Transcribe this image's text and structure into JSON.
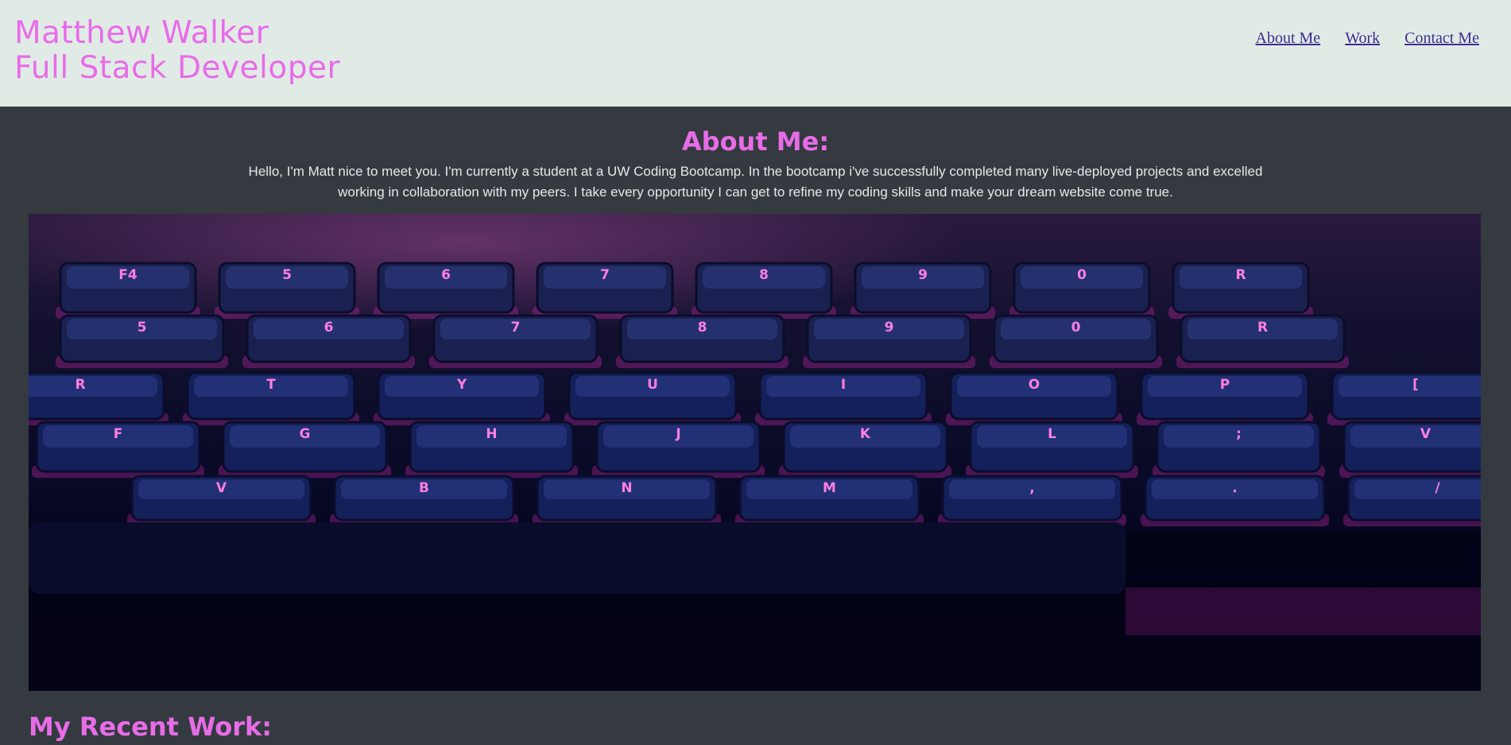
{
  "header": {
    "name": "Matthew Walker",
    "role": "Full Stack Developer"
  },
  "nav": {
    "items": [
      "About Me",
      "Work",
      "Contact Me"
    ]
  },
  "about": {
    "title": "About Me:",
    "text": "Hello, I'm Matt nice to meet you. I'm currently a student at a UW Coding Bootcamp. In the bootcamp i've successfully completed many live-deployed projects and excelled working in collaboration with my peers. I take every opportunity I can get to refine my coding skills and make your dream website come true."
  },
  "hero": {
    "image": "keyboard-photo",
    "key_labels": [
      "F4",
      "5",
      "6",
      "7",
      "8",
      "9",
      "0",
      "R",
      "T",
      "Y",
      "U",
      "I",
      "O",
      "P",
      "[",
      "F",
      "G",
      "H",
      "J",
      "K",
      "L",
      ";",
      "V",
      "B",
      "N",
      "M",
      ",",
      ".",
      "/"
    ]
  },
  "work": {
    "title": "My Recent Work:"
  },
  "colors": {
    "accent": "#e86ce8",
    "header_bg": "#e1ebe6",
    "page_bg": "#343a40",
    "nav_link": "#3e2d91"
  }
}
